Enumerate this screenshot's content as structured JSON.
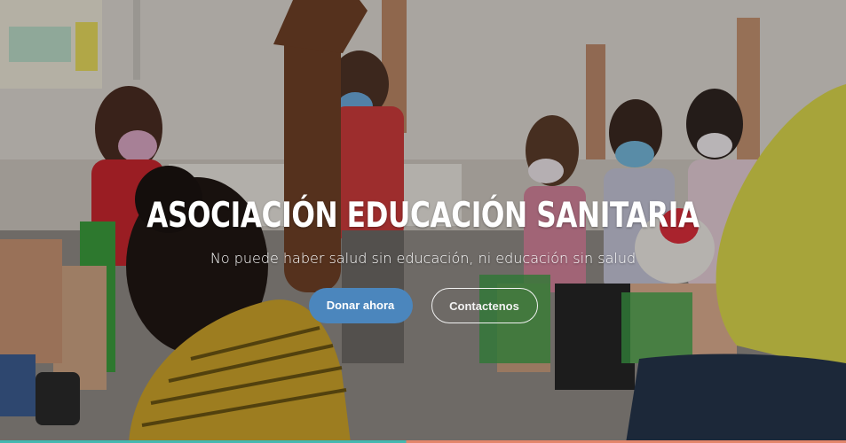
{
  "hero": {
    "background_image": "children-classroom-hands-raised-photo",
    "title": "ASOCIACIÓN EDUCACIÓN SANITARIA",
    "subtitle": "No puede haber salud sin educación, ni educación sin salud",
    "primary_button_label": "Donar ahora",
    "secondary_button_label": "Contactenos"
  },
  "colors": {
    "primary_button": "#4b86bd",
    "title_text": "#ffffff",
    "bottom_bar_left": "#43b8b0",
    "bottom_bar_right": "#e3866b"
  }
}
